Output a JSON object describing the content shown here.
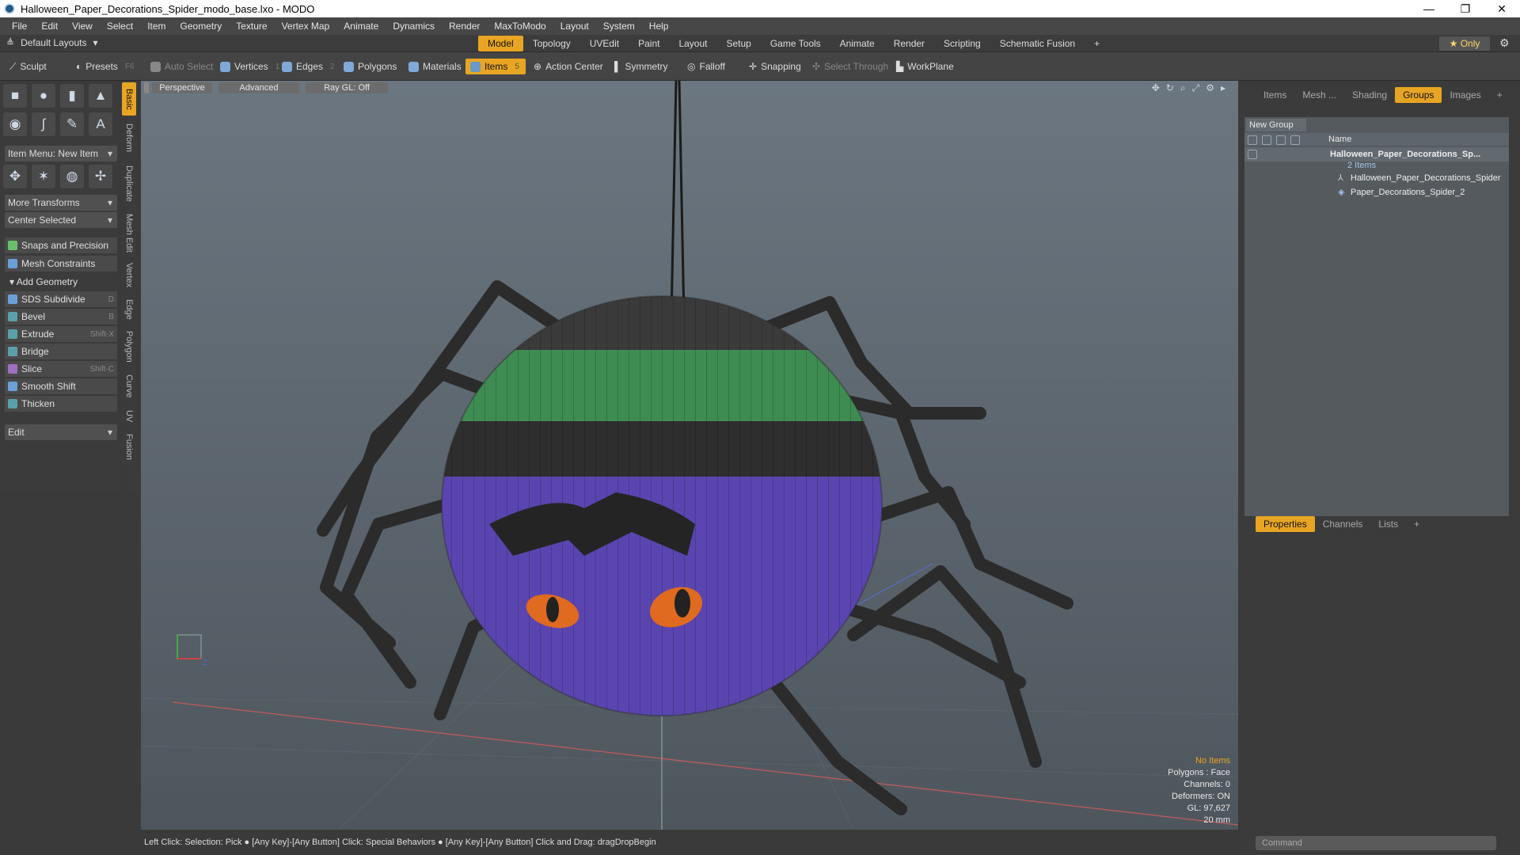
{
  "window": {
    "title": "Halloween_Paper_Decorations_Spider_modo_base.lxo - MODO",
    "controls": [
      "—",
      "❐",
      "✕"
    ]
  },
  "menu": [
    "File",
    "Edit",
    "View",
    "Select",
    "Item",
    "Geometry",
    "Texture",
    "Vertex Map",
    "Animate",
    "Dynamics",
    "Render",
    "MaxToModo",
    "Layout",
    "System",
    "Help"
  ],
  "layoutbar": {
    "default_layouts": "Default Layouts",
    "tabs": [
      "Model",
      "Topology",
      "UVEdit",
      "Paint",
      "Layout",
      "Setup",
      "Game Tools",
      "Animate",
      "Render",
      "Scripting",
      "Schematic Fusion"
    ],
    "active_tab": "Model",
    "only_label": "Only"
  },
  "toolbar": {
    "sculpt": "Sculpt",
    "presets": "Presets",
    "presets_key": "F6",
    "auto_select": "Auto Select",
    "vertices": "Vertices",
    "vertices_num": "1",
    "edges": "Edges",
    "edges_num": "2",
    "polygons": "Polygons",
    "materials": "Materials",
    "items": "Items",
    "items_num": "5",
    "action_center": "Action Center",
    "symmetry": "Symmetry",
    "falloff": "Falloff",
    "snapping": "Snapping",
    "select_through": "Select Through",
    "workplane": "WorkPlane"
  },
  "leftpanel": {
    "item_menu": "Item Menu: New Item",
    "more_transforms": "More Transforms",
    "center_selected": "Center Selected",
    "snaps": "Snaps and Precision",
    "mesh_constraints": "Mesh Constraints",
    "add_geometry": "Add Geometry",
    "tools": [
      {
        "label": "SDS Subdivide",
        "shortcut": "D",
        "color": "#6aa0d8"
      },
      {
        "label": "Bevel",
        "shortcut": "B",
        "color": "#5aa0a8"
      },
      {
        "label": "Extrude",
        "shortcut": "Shift-X",
        "color": "#5aa0a8"
      },
      {
        "label": "Bridge",
        "shortcut": "",
        "color": "#5aa0a8"
      },
      {
        "label": "Slice",
        "shortcut": "Shift-C",
        "color": "#a070c0"
      },
      {
        "label": "Smooth Shift",
        "shortcut": "",
        "color": "#6aa0d8"
      },
      {
        "label": "Thicken",
        "shortcut": "",
        "color": "#5aa0a8"
      }
    ],
    "edit": "Edit"
  },
  "vtabs": [
    "Basic",
    "Deform",
    "Duplicate",
    "Mesh Edit",
    "Vertex",
    "Edge",
    "Polygon",
    "Curve",
    "UV",
    "Fusion"
  ],
  "viewport": {
    "perspective": "Perspective",
    "advanced": "Advanced",
    "raygl": "Ray GL: Off",
    "info": {
      "no_items": "No Items",
      "polygons": "Polygons : Face",
      "channels": "Channels: 0",
      "deformers": "Deformers: ON",
      "gl": "GL: 97,627",
      "scale": "20 mm"
    }
  },
  "status": "Left Click: Selection: Pick ● [Any Key]-[Any Button] Click: Special Behaviors ● [Any Key]-[Any Button] Click and Drag: dragDropBegin",
  "rightpanel": {
    "tabs": [
      "Items",
      "Mesh ...",
      "Shading",
      "Groups",
      "Images"
    ],
    "active_tab": "Groups",
    "new_group": "New Group",
    "name_col": "Name",
    "group_name": "Halloween_Paper_Decorations_Sp...",
    "group_count": "2 Items",
    "children": [
      "Halloween_Paper_Decorations_Spider",
      "Paper_Decorations_Spider_2"
    ],
    "bottom_tabs": [
      "Properties",
      "Channels",
      "Lists"
    ],
    "command_placeholder": "Command"
  }
}
